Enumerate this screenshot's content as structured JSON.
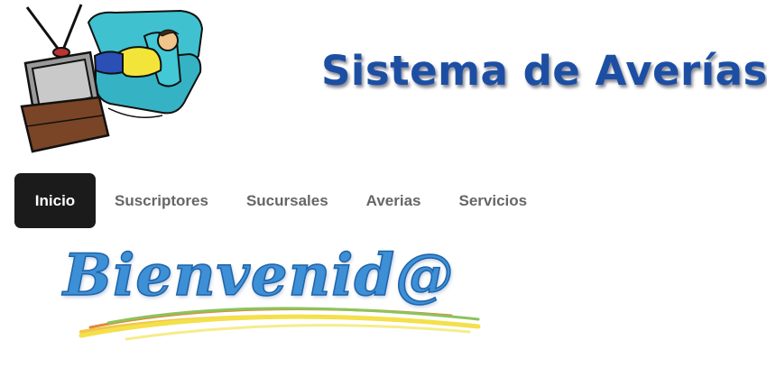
{
  "header": {
    "title": "Sistema de Averías",
    "logo_icon": "tv-couch-icon"
  },
  "nav": {
    "items": [
      {
        "label": "Inicio",
        "active": true
      },
      {
        "label": "Suscriptores",
        "active": false
      },
      {
        "label": "Sucursales",
        "active": false
      },
      {
        "label": "Averias",
        "active": false
      },
      {
        "label": "Servicios",
        "active": false
      }
    ]
  },
  "main": {
    "welcome_text": "Bienvenid@"
  },
  "colors": {
    "title_blue": "#1c4fa3",
    "nav_active_bg": "#1b1b1b",
    "nav_text": "#666666",
    "welcome_blue": "#3d8fd6"
  }
}
